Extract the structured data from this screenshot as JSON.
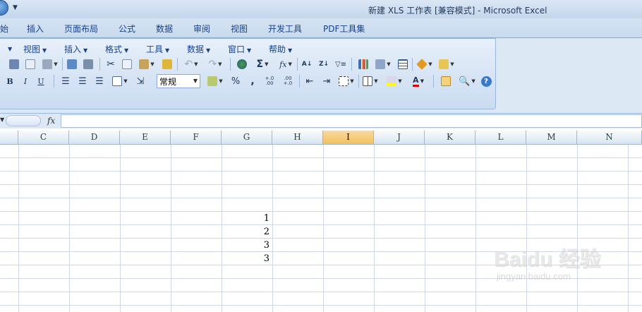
{
  "title_bar": {
    "title": "新建 XLS 工作表 [兼容模式] - Microsoft Excel"
  },
  "ribbon_tabs": [
    {
      "label": "始"
    },
    {
      "label": "插入"
    },
    {
      "label": "页面布局"
    },
    {
      "label": "公式"
    },
    {
      "label": "数据"
    },
    {
      "label": "审阅"
    },
    {
      "label": "视图"
    },
    {
      "label": "开发工具"
    },
    {
      "label": "PDF工具集"
    }
  ],
  "classic_menu": [
    {
      "label": "视图"
    },
    {
      "label": "插入"
    },
    {
      "label": "格式"
    },
    {
      "label": "工具"
    },
    {
      "label": "数据"
    },
    {
      "label": "窗口"
    },
    {
      "label": "帮助"
    }
  ],
  "format_toolbar": {
    "bold": "B",
    "italic": "I",
    "underline": "U",
    "number_style": "常规",
    "percent": "%",
    "comma": ",",
    "inc_decimal": "+.0 .00",
    "dec_decimal": ".00 +.0"
  },
  "standard_toolbar": {
    "sum": "Σ",
    "function": "fx"
  },
  "formula_bar": {
    "fx_label": "fx",
    "value": ""
  },
  "columns": [
    "C",
    "D",
    "E",
    "F",
    "G",
    "H",
    "I",
    "J",
    "K",
    "L",
    "M",
    "N"
  ],
  "active_column": "I",
  "cells": [
    {
      "column": "H",
      "value": "1"
    },
    {
      "column": "H",
      "value": "2"
    },
    {
      "column": "H",
      "value": "3"
    },
    {
      "column": "H",
      "value": "3"
    }
  ],
  "watermark": {
    "brand": "Baidu 经验",
    "url": "jingyan.baidu.com"
  },
  "colors": {
    "title_bar": "#c4d6ec",
    "active_column_header": "#f1c15f",
    "gridline": "#d0d7e5"
  }
}
